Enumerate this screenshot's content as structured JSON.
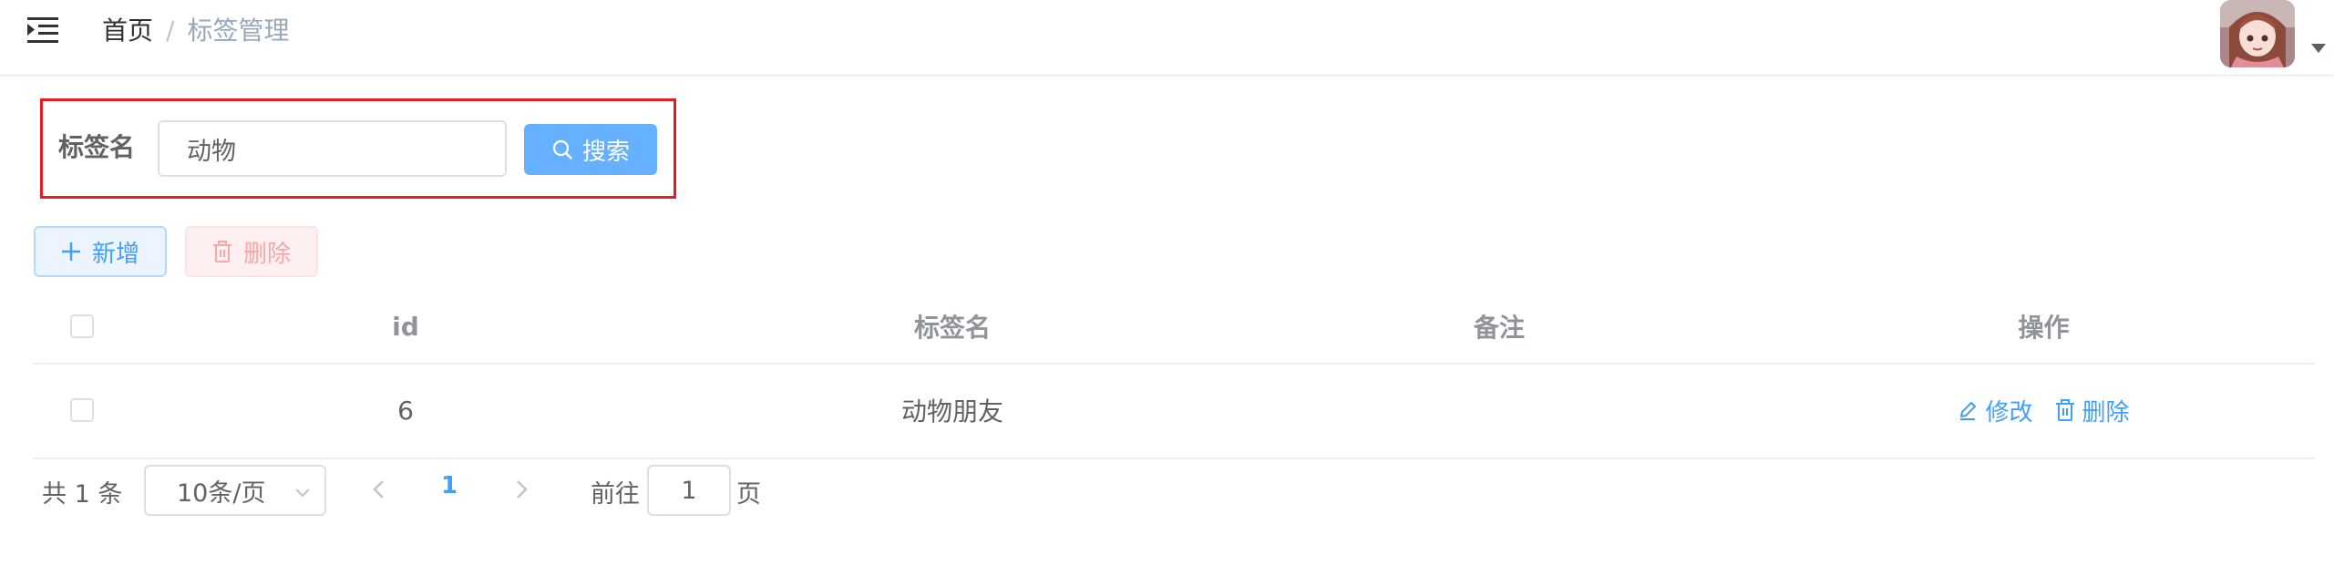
{
  "header": {
    "breadcrumb_home": "首页",
    "breadcrumb_separator": "/",
    "breadcrumb_current": "标签管理",
    "menu_icon": "indent-menu-icon",
    "avatar_icon": "anime-avatar"
  },
  "search": {
    "label": "标签名",
    "value": "动物",
    "button_label": "搜索",
    "button_icon": "search-icon"
  },
  "toolbar": {
    "add_label": "新增",
    "add_icon": "plus-icon",
    "delete_label": "删除",
    "delete_icon": "trash-icon"
  },
  "table": {
    "columns": [
      "id",
      "标签名",
      "备注",
      "操作"
    ],
    "rows": [
      {
        "id": "6",
        "name": "动物朋友",
        "remark": "",
        "edit_label": "修改",
        "delete_label": "删除"
      }
    ]
  },
  "pagination": {
    "total": "共 1 条",
    "page_size": "10条/页",
    "current_page": "1",
    "goto_label": "前往",
    "goto_value": "1",
    "page_suffix": "页"
  },
  "colors": {
    "primary": "#409eff",
    "search_button": "#66b1ff",
    "danger_light": "#f9a7a7",
    "highlight_border": "#e51c23"
  }
}
